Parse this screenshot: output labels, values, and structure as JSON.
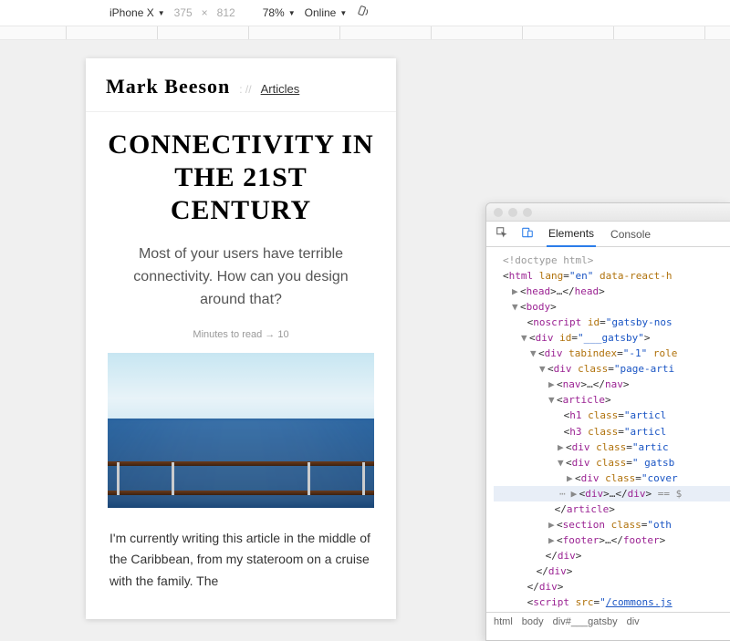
{
  "toolbar": {
    "device": "iPhone X",
    "width": "375",
    "times": "×",
    "height": "812",
    "zoom": "78%",
    "network": "Online"
  },
  "page": {
    "site_name": "Mark Beeson",
    "breadcrumb_sep": ": //",
    "breadcrumb_link": "Articles",
    "title": "Connectivity in the 21st century",
    "subtitle": "Most of your users have terrible connectivity. How can you design around that?",
    "read_time": "Minutes to read → 10",
    "body_p1": "I'm currently writing this article in the middle of the Caribbean, from my stateroom on a cruise with the family. The"
  },
  "devtools": {
    "tabs": {
      "elements": "Elements",
      "console": "Console"
    },
    "dom": {
      "doctype": "<!doctype html>",
      "html_open": "html",
      "html_attrs": "lang=\"en\" data-react-h",
      "head": "head",
      "body": "body",
      "noscript_id": "gatsby-nos",
      "gatsby_id": "___gatsby",
      "tabindex": "-1",
      "role_attr": "role",
      "page_class": "page-arti",
      "nav": "nav",
      "article": "article",
      "h1_class": "articl",
      "h3_class": "articl",
      "div_artic": "artic",
      "gatsb_class": " gatsb",
      "cover_class": "cover",
      "sel_div": "div",
      "eq": " == $",
      "section_class": "oth",
      "footer": "footer",
      "script_src": "/commons.js"
    },
    "crumbs": [
      "html",
      "body",
      "div#___gatsby",
      "div"
    ]
  }
}
